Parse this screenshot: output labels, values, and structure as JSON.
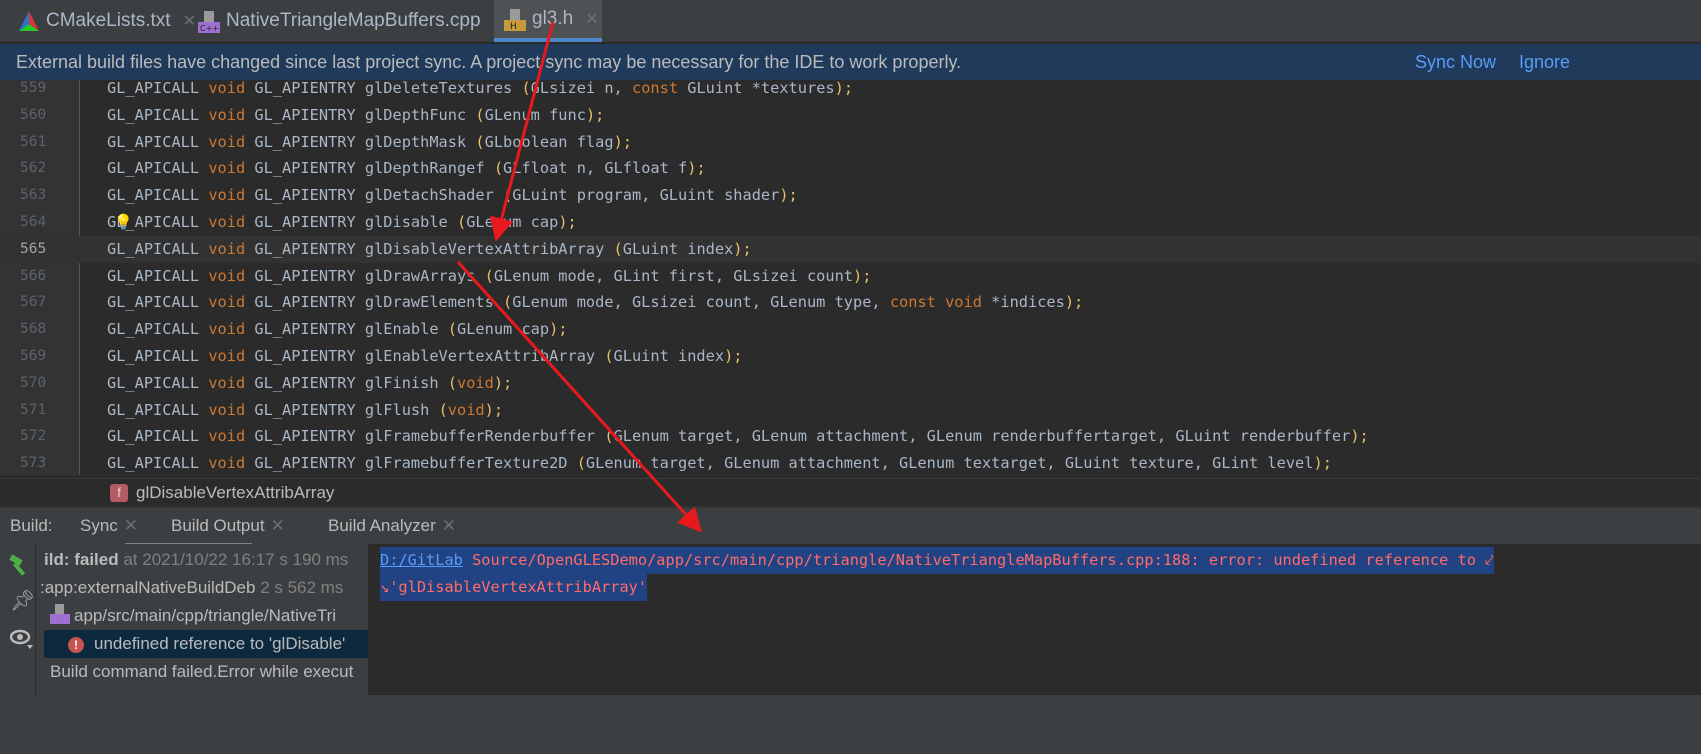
{
  "tabs": [
    {
      "label": "CMakeLists.txt",
      "icon": "cmake-icon"
    },
    {
      "label": "NativeTriangleMapBuffers.cpp",
      "icon": "cpp-file-icon"
    },
    {
      "label": "gl3.h",
      "icon": "header-file-icon",
      "active": true
    }
  ],
  "banner": {
    "message": "External build files have changed since last project sync. A project sync may be necessary for the IDE to work properly.",
    "sync_now": "Sync Now",
    "ignore": "Ignore"
  },
  "editor": {
    "current_line": "565",
    "lines": [
      {
        "n": "559",
        "t": [
          [
            "GL_APICALL ",
            ""
          ],
          [
            "void",
            "kw"
          ],
          [
            " GL_APIENTRY glDeleteTextures ",
            ""
          ],
          [
            "(",
            "pn"
          ],
          [
            "GLsizei n, ",
            ""
          ],
          [
            "const",
            "kw"
          ],
          [
            " GLuint *textures",
            ""
          ],
          [
            ");",
            "pn"
          ]
        ]
      },
      {
        "n": "560",
        "t": [
          [
            "GL_APICALL ",
            ""
          ],
          [
            "void",
            "kw"
          ],
          [
            " GL_APIENTRY glDepthFunc ",
            ""
          ],
          [
            "(",
            "pn"
          ],
          [
            "GLenum func",
            ""
          ],
          [
            ");",
            "pn"
          ]
        ]
      },
      {
        "n": "561",
        "t": [
          [
            "GL_APICALL ",
            ""
          ],
          [
            "void",
            "kw"
          ],
          [
            " GL_APIENTRY glDepthMask ",
            ""
          ],
          [
            "(",
            "pn"
          ],
          [
            "GLboolean flag",
            ""
          ],
          [
            ");",
            "pn"
          ]
        ]
      },
      {
        "n": "562",
        "t": [
          [
            "GL_APICALL ",
            ""
          ],
          [
            "void",
            "kw"
          ],
          [
            " GL_APIENTRY glDepthRangef ",
            ""
          ],
          [
            "(",
            "pn"
          ],
          [
            "GLfloat n, GLfloat f",
            ""
          ],
          [
            ");",
            "pn"
          ]
        ]
      },
      {
        "n": "563",
        "t": [
          [
            "GL_APICALL ",
            ""
          ],
          [
            "void",
            "kw"
          ],
          [
            " GL_APIENTRY glDetachShader ",
            ""
          ],
          [
            "(",
            "pn"
          ],
          [
            "GLuint program, GLuint shader",
            ""
          ],
          [
            ");",
            "pn"
          ]
        ]
      },
      {
        "n": "564",
        "t": [
          [
            "GL_APICALL ",
            ""
          ],
          [
            "void",
            "kw"
          ],
          [
            " GL_APIENTRY glDisable ",
            ""
          ],
          [
            "(",
            "pn"
          ],
          [
            "GLenum cap",
            ""
          ],
          [
            ");",
            "pn"
          ]
        ]
      },
      {
        "n": "565",
        "t": [
          [
            "GL_APICALL ",
            ""
          ],
          [
            "void",
            "kw"
          ],
          [
            " GL_APIENTRY glDisableVertexAttribArray ",
            ""
          ],
          [
            "(",
            "pn"
          ],
          [
            "GLuint index",
            ""
          ],
          [
            ");",
            "pn"
          ]
        ]
      },
      {
        "n": "566",
        "t": [
          [
            "GL_APICALL ",
            ""
          ],
          [
            "void",
            "kw"
          ],
          [
            " GL_APIENTRY glDrawArrays ",
            ""
          ],
          [
            "(",
            "pn"
          ],
          [
            "GLenum mode, GLint first, GLsizei count",
            ""
          ],
          [
            ");",
            "pn"
          ]
        ]
      },
      {
        "n": "567",
        "t": [
          [
            "GL_APICALL ",
            ""
          ],
          [
            "void",
            "kw"
          ],
          [
            " GL_APIENTRY glDrawElements ",
            ""
          ],
          [
            "(",
            "pn"
          ],
          [
            "GLenum mode, GLsizei count, GLenum type, ",
            ""
          ],
          [
            "const void",
            "kw"
          ],
          [
            " *indices",
            ""
          ],
          [
            ");",
            "pn"
          ]
        ]
      },
      {
        "n": "568",
        "t": [
          [
            "GL_APICALL ",
            ""
          ],
          [
            "void",
            "kw"
          ],
          [
            " GL_APIENTRY glEnable ",
            ""
          ],
          [
            "(",
            "pn"
          ],
          [
            "GLenum cap",
            ""
          ],
          [
            ");",
            "pn"
          ]
        ]
      },
      {
        "n": "569",
        "t": [
          [
            "GL_APICALL ",
            ""
          ],
          [
            "void",
            "kw"
          ],
          [
            " GL_APIENTRY glEnableVertexAttribArray ",
            ""
          ],
          [
            "(",
            "pn"
          ],
          [
            "GLuint index",
            ""
          ],
          [
            ");",
            "pn"
          ]
        ]
      },
      {
        "n": "570",
        "t": [
          [
            "GL_APICALL ",
            ""
          ],
          [
            "void",
            "kw"
          ],
          [
            " GL_APIENTRY glFinish ",
            ""
          ],
          [
            "(",
            "pn"
          ],
          [
            "void",
            "kw"
          ],
          [
            ");",
            "pn"
          ]
        ]
      },
      {
        "n": "571",
        "t": [
          [
            "GL_APICALL ",
            ""
          ],
          [
            "void",
            "kw"
          ],
          [
            " GL_APIENTRY glFlush ",
            ""
          ],
          [
            "(",
            "pn"
          ],
          [
            "void",
            "kw"
          ],
          [
            ");",
            "pn"
          ]
        ]
      },
      {
        "n": "572",
        "t": [
          [
            "GL_APICALL ",
            ""
          ],
          [
            "void",
            "kw"
          ],
          [
            " GL_APIENTRY glFramebufferRenderbuffer ",
            ""
          ],
          [
            "(",
            "pn"
          ],
          [
            "GLenum target, GLenum attachment, GLenum renderbuffertarget, GLuint renderbuffer",
            ""
          ],
          [
            ");",
            "pn"
          ]
        ]
      },
      {
        "n": "573",
        "t": [
          [
            "GL_APICALL ",
            ""
          ],
          [
            "void",
            "kw"
          ],
          [
            " GL_APIENTRY glFramebufferTexture2D ",
            ""
          ],
          [
            "(",
            "pn"
          ],
          [
            "GLenum target, GLenum attachment, GLenum textarget, GLuint texture, GLint level",
            ""
          ],
          [
            ");",
            "pn"
          ]
        ]
      }
    ]
  },
  "breadcrumb": {
    "badge": "f",
    "label": "glDisableVertexAttribArray"
  },
  "build": {
    "label": "Build:",
    "tabs": [
      {
        "label": "Sync"
      },
      {
        "label": "Build Output",
        "active": true
      },
      {
        "label": "Build Analyzer"
      }
    ],
    "tree": [
      {
        "main": "ild: failed",
        "meta": " at 2021/10/22 16:17 s 190 ms"
      },
      {
        "main": ":app:externalNativeBuildDeb",
        "meta": " 2 s 562 ms"
      },
      {
        "main": "app/src/main/cpp/triangle/NativeTri",
        "meta": ""
      },
      {
        "main": "undefined reference to 'glDisable'",
        "meta": ""
      },
      {
        "main": "Build command failed.Error while execut",
        "meta": ""
      }
    ],
    "output": {
      "link": "D:/GitLab",
      "line1": " Source/OpenGLESDemo/app/src/main/cpp/triangle/NativeTriangleMapBuffers.cpp:188: error: undefined reference to ⤦",
      "line2": "↘'glDisableVertexAttribArray'"
    }
  },
  "colors": {
    "arrow": "#e8191c",
    "accent": "#4a88c7",
    "error": "#ff6b68",
    "link": "#589df6"
  }
}
